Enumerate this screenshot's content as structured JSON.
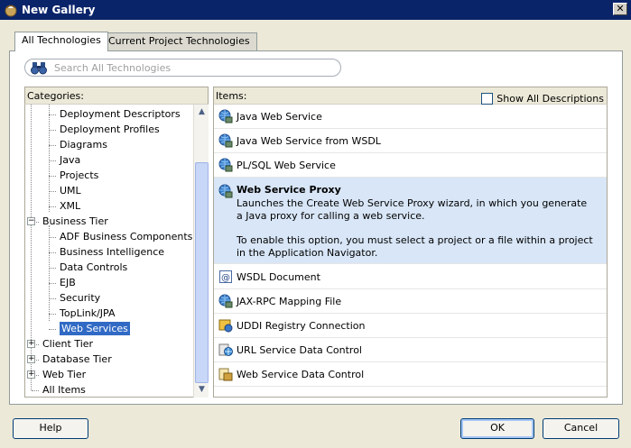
{
  "window": {
    "title": "New Gallery",
    "close_glyph": "✕"
  },
  "tabs": [
    {
      "label": "All Technologies",
      "active": true
    },
    {
      "label": "Current Project Technologies",
      "active": false
    }
  ],
  "search": {
    "placeholder": "Search All Technologies",
    "value": ""
  },
  "categories": {
    "header": "Categories:",
    "items": [
      {
        "label": "Deployment Descriptors"
      },
      {
        "label": "Deployment Profiles"
      },
      {
        "label": "Diagrams"
      },
      {
        "label": "Java"
      },
      {
        "label": "Projects"
      },
      {
        "label": "UML"
      },
      {
        "label": "XML"
      },
      {
        "label": "Business Tier",
        "expander": "−"
      },
      {
        "label": "ADF Business Components"
      },
      {
        "label": "Business Intelligence"
      },
      {
        "label": "Data Controls"
      },
      {
        "label": "EJB"
      },
      {
        "label": "Security"
      },
      {
        "label": "TopLink/JPA"
      },
      {
        "label": "Web Services",
        "selected": true
      },
      {
        "label": "Client Tier",
        "expander": "+"
      },
      {
        "label": "Database Tier",
        "expander": "+"
      },
      {
        "label": "Web Tier",
        "expander": "+"
      },
      {
        "label": "All Items"
      }
    ]
  },
  "items_panel": {
    "header": "Items:",
    "show_all_label": "Show All Descriptions",
    "show_all_checked": false,
    "items": [
      {
        "title": "Java Web Service",
        "icon": "web-service-globe-icon"
      },
      {
        "title": "Java Web Service from WSDL",
        "icon": "web-service-globe-icon"
      },
      {
        "title": "PL/SQL Web Service",
        "icon": "web-service-globe-icon"
      },
      {
        "title": "Web Service Proxy",
        "icon": "web-service-globe-icon",
        "selected": true,
        "description": "Launches the Create Web Service Proxy wizard, in which you generate a Java proxy for calling a web service.",
        "note": "To enable this option, you must select a project or a file within a project in the Application Navigator."
      },
      {
        "title": "WSDL Document",
        "icon": "wsdl-document-icon"
      },
      {
        "title": "JAX-RPC Mapping File",
        "icon": "web-service-globe-icon"
      },
      {
        "title": "UDDI Registry Connection",
        "icon": "uddi-connection-icon"
      },
      {
        "title": "URL Service Data Control",
        "icon": "url-data-control-icon"
      },
      {
        "title": "Web Service Data Control",
        "icon": "ws-data-control-icon"
      }
    ]
  },
  "buttons": {
    "help": "Help",
    "ok": "OK",
    "cancel": "Cancel"
  },
  "colors": {
    "titlebar": "#0a246a",
    "selection": "#316ac5",
    "selected_item_bg": "#d8e6f7",
    "dialog_bg": "#ece9d8"
  }
}
